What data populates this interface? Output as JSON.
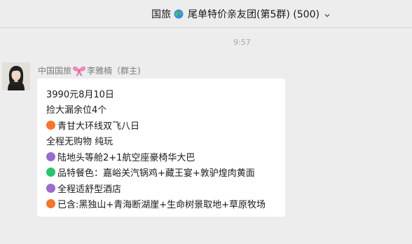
{
  "header": {
    "title_prefix": "国旅",
    "title_suffix": "尾单特价亲友团(第5群) (500)",
    "globe_icon": "globe-icon",
    "chevron_icon": "chevron-down-icon"
  },
  "chat": {
    "timestamp": "9:57",
    "message": {
      "sender_prefix": "中国国旅",
      "sender_suffix": "李雅楠（群主)",
      "bow_icon": "ribbon-bow-icon",
      "lines": [
        {
          "text": "3990元8月10日",
          "dot": ""
        },
        {
          "text": "捡大漏余位4个",
          "dot": ""
        },
        {
          "text": "青甘大环线双飞八日",
          "dot": "#f47530"
        },
        {
          "text": "全程无购物 纯玩",
          "dot": ""
        },
        {
          "text": "陆地头等舱2+1航空座豪椅华大巴",
          "dot": "#9b6ccf"
        },
        {
          "text": "品特餐色：嘉峪关汽锅鸡+藏王宴+敦驴煌肉黄面",
          "dot": "#2cc36b"
        },
        {
          "text": "全程适舒型酒店",
          "dot": "#9b6ccf"
        },
        {
          "text": "已含:黑独山+青海断湖崖+生命树景取地+草原牧场",
          "dot": "#f47530"
        }
      ]
    }
  },
  "colors": {
    "background": "#ededed",
    "bubble": "#ffffff",
    "orange": "#f47530",
    "purple": "#9b6ccf",
    "green": "#2cc36b"
  }
}
